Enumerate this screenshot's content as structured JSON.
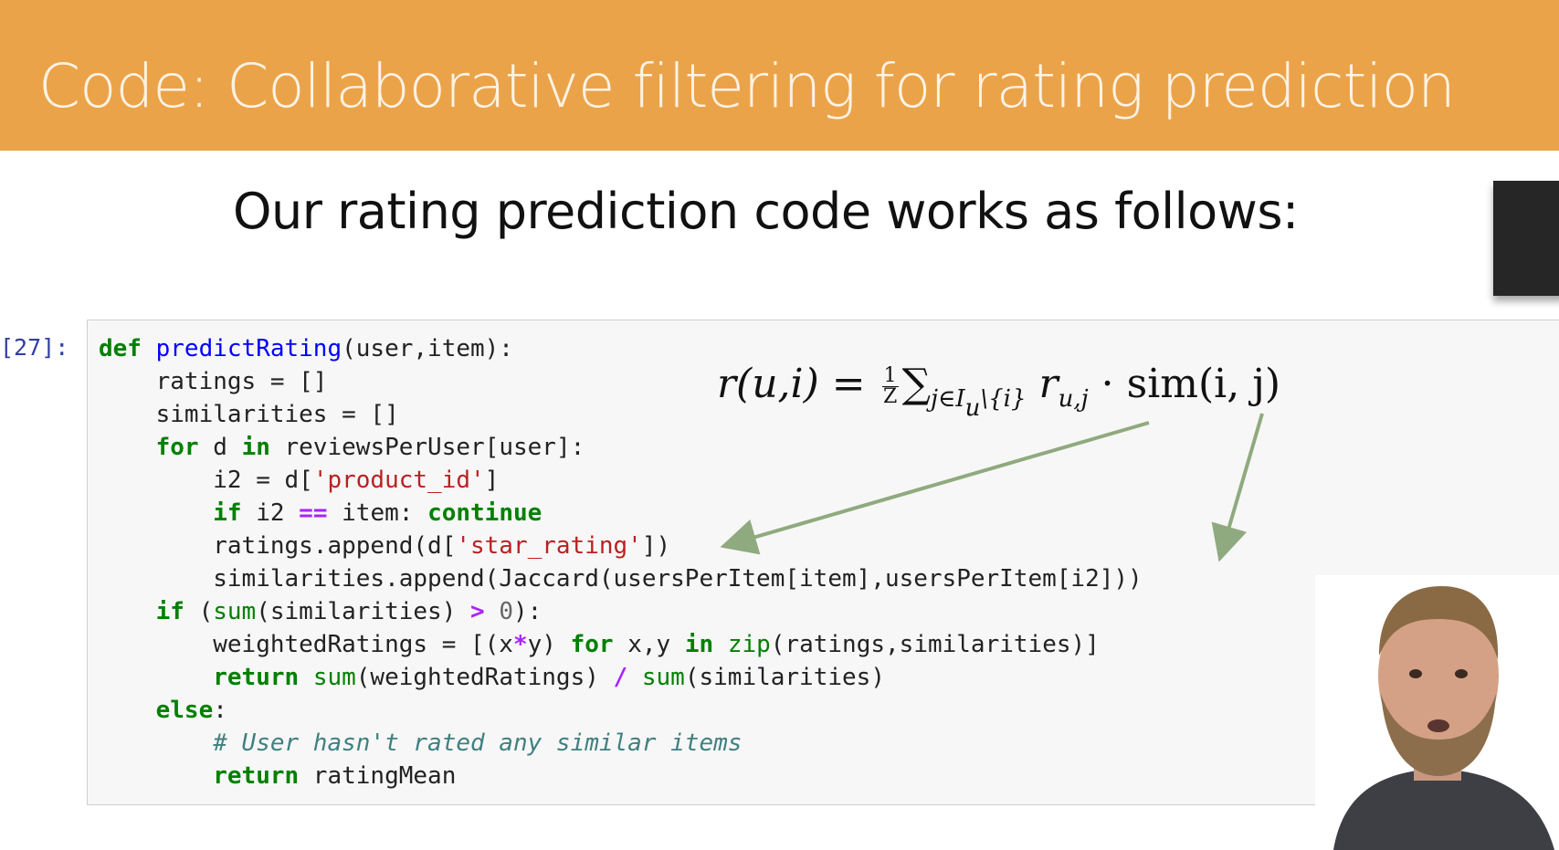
{
  "slide": {
    "title": "Code: Collaborative filtering for rating prediction",
    "subtitle": "Our rating prediction code works as follows:"
  },
  "cell": {
    "prompt": "[27]:"
  },
  "formula": {
    "lhs": "r(u,i) = ",
    "frac_num": "1",
    "frac_den": "Z",
    "sum": "∑",
    "sum_sub": "j∈I",
    "sum_sub_u": "u",
    "sum_sub_rest": "\\{i}",
    "r": "r",
    "r_sub": "u,j",
    "dot": " · ",
    "sim": "sim",
    "sim_args": "(i, j)"
  },
  "code": {
    "l1": {
      "def": "def",
      "name": "predictRating",
      "args": "(user,item):"
    },
    "l2": {
      "text": "ratings = []"
    },
    "l3": {
      "text": "similarities = []"
    },
    "l4": {
      "for": "for",
      "mid": " d ",
      "in": "in",
      "rest": " reviewsPerUser[user]:"
    },
    "l5": {
      "pre": "i2 = d[",
      "str": "'product_id'",
      "post": "]"
    },
    "l6": {
      "if": "if",
      "mid": " i2 ",
      "op": "==",
      "rest": " item: ",
      "cont": "continue"
    },
    "l7": {
      "pre": "ratings.append(d[",
      "str": "'star_rating'",
      "post": "])"
    },
    "l8": {
      "text": "similarities.append(Jaccard(usersPerItem[item],usersPerItem[i2]))"
    },
    "l9": {
      "if": "if",
      "pre": " (",
      "sum": "sum",
      "mid": "(similarities) ",
      "op": ">",
      "sp": " ",
      "num": "0",
      "post": "):"
    },
    "l10": {
      "pre": "weightedRatings = [(x",
      "op": "*",
      "mid": "y) ",
      "for": "for",
      "mid2": " x,y ",
      "in": "in",
      "sp": " ",
      "zip": "zip",
      "post": "(ratings,similarities)]"
    },
    "l11": {
      "ret": "return",
      "sp": " ",
      "sum1": "sum",
      "mid": "(weightedRatings) ",
      "op": "/",
      "sp2": " ",
      "sum2": "sum",
      "post": "(similarities)"
    },
    "l12": {
      "else": "else",
      "post": ":"
    },
    "l13": {
      "comment": "# User hasn't rated any similar items"
    },
    "l14": {
      "ret": "return",
      "post": " ratingMean"
    }
  },
  "colors": {
    "header_band": "#eba34a",
    "arrow": "#8faa7e",
    "keyword": "#008000",
    "function_name": "#0000ff",
    "string": "#ba2121"
  }
}
